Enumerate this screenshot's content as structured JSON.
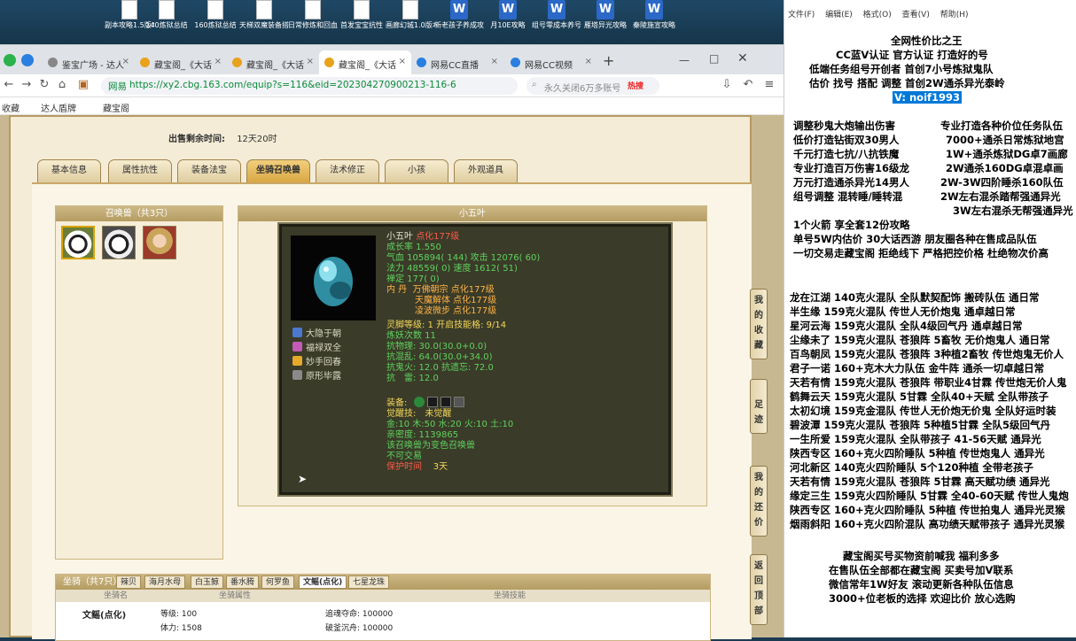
{
  "desktop_icons": [
    {
      "label": "副本攻略1.5版本",
      "type": "doc"
    },
    {
      "label": "140炼狱总结",
      "type": "doc"
    },
    {
      "label": "160炼狱总结",
      "type": "doc"
    },
    {
      "label": "天梯双魔装备搭配",
      "type": "doc"
    },
    {
      "label": "日常修炼和回血鬼搭配",
      "type": "doc"
    },
    {
      "label": "首发宝宝抗性",
      "type": "doc"
    },
    {
      "label": "画廊幻城1.0版本",
      "type": "doc"
    },
    {
      "label": "新老孩子养成攻略",
      "type": "word"
    },
    {
      "label": "月10E攻略",
      "type": "word"
    },
    {
      "label": "组号零成本养号",
      "type": "word"
    },
    {
      "label": "雁塔异光攻略",
      "type": "word"
    },
    {
      "label": "秦陵施宣攻略",
      "type": "word"
    }
  ],
  "browser": {
    "tabs": [
      {
        "label": "鉴宝广场 - 达人",
        "active": false
      },
      {
        "label": "藏宝阁_《大话",
        "active": false
      },
      {
        "label": "藏宝阁_《大话",
        "active": false
      },
      {
        "label": "藏宝阁_《大话",
        "active": true
      },
      {
        "label": "网易CC直播",
        "active": false
      },
      {
        "label": "网易CC视频",
        "active": false
      }
    ],
    "url_host": "网易",
    "url": "https://xy2.cbg.163.com/equip?s=116&eid=202304270900213-116-6",
    "search_placeholder": "永久关闭6万多账号",
    "hot_label": "热搜",
    "bookmarks": [
      "收藏",
      "达人盾牌",
      "藏宝阁"
    ]
  },
  "listing": {
    "time_left_label": "出售剩余时间:",
    "time_left_value": "12天20时",
    "tabs": [
      "基本信息",
      "属性抗性",
      "装备法宝",
      "坐骑召唤兽",
      "法术修正",
      "小孩",
      "外观道具"
    ],
    "active_tab": "坐骑召唤兽",
    "pet_list_title": "召唤兽（共3只）",
    "pet_detail_title": "小五叶"
  },
  "pet": {
    "name": "小五叶",
    "tag": "点化177级",
    "growth": "成长率 1.550",
    "hp": "气血 105894( 144)",
    "atk": "攻击 12076( 60)",
    "mp": "法力 48559( 0)",
    "spd": "速度 1612( 51)",
    "ding": "禅定 177( 0)",
    "inner_label": "内 丹",
    "inner": [
      "万佛朝宗 点化177级",
      "天魔解体 点化177级",
      "凌波微步 点化177级"
    ],
    "skills": [
      "大隐于朝",
      "福禄双全",
      "妙手回春",
      "原形毕露"
    ],
    "spirit": "灵脚等级: 1 开启技能格: 9/14",
    "refine": "炼妖次数 11",
    "res1": "抗物理: 30.0(30.0+0.0)",
    "res2": "抗混乱: 64.0(30.0+34.0)",
    "res3a": "抗鬼火: 12.0",
    "res3b": "抗遗忘: 72.0",
    "res4": "抗　雷: 12.0",
    "equip_label": "装备:",
    "awaken": "觉醒技:　未觉醒",
    "elements": "金:10 木:50 水:20 火:10 土:10",
    "close": "亲密度: 1139865",
    "note1": "该召唤兽为变色召唤兽",
    "note2": "不可交易",
    "protect_label": "保护时间",
    "protect_value": "3天"
  },
  "mounts": {
    "header": "坐骑（共7只）",
    "tabs": [
      "辣贝",
      "海月水母",
      "白玉鲸",
      "番水腾",
      "何罗鱼",
      "文鳐(点化)",
      "七星龙珠"
    ],
    "active_tab": "文鳐(点化)",
    "cols": [
      "坐骑名",
      "坐骑属性",
      "坐骑技能"
    ],
    "name": "文鳐(点化)",
    "level": "等级: 100",
    "body": "体力: 1508",
    "chase": "追魂夺命: 100000",
    "wave": "破釜沉舟: 100000"
  },
  "side_buttons": [
    "我的收藏",
    "足迹",
    "我的还价",
    "返回顶部"
  ],
  "notepad": {
    "menu": [
      "文件(F)",
      "编辑(E)",
      "格式(O)",
      "查看(V)",
      "帮助(H)"
    ],
    "header_lines": [
      "全网性价比之王",
      "CC蓝V认证 官方认证 打造好的号",
      "低端任务组号开创者     首创7小号炼狱鬼队",
      "估价 找号 搭配 调整        首创2W通杀异光泰岭"
    ],
    "contact": "V: noif1993",
    "services_left": [
      "调整秒鬼大炮输出伤害",
      "低价打造钻街双30男人",
      "千元打造七抗/八抗铁魔",
      "专业打造百万伤害16级龙",
      "万元打造通杀异光14男人",
      "组号调整 混转睡/睡转混"
    ],
    "services_right": [
      "专业打造各种价位任务队伍",
      "7000+通杀日常炼狱地宫",
      "1W+通杀炼狱DG卓7画廊",
      "2W通杀160DG卓混卓画",
      "2W-3W四阶睡杀160队伍",
      "2W左右混杀踏帮强通异光",
      "3W左右混杀无帮强通异光"
    ],
    "promo": [
      "1个火箭 享全套12份攻略",
      "单号5W内估价 30大话西游        朋友圈各种在售成品队伍",
      "一切交易走藏宝阁 拒绝线下    严格把控价格 杜绝物次价高"
    ],
    "teams": [
      "龙在江湖 140克火混队 全队默契配饰 搬砖队伍 通日常",
      "半生缘     159克火混队 传世人无价炮鬼 通卓越日常",
      "星河云海 159克火混队 全队4级回气丹 通卓越日常",
      "尘缘未了 159克火混队 苍狼阵 5畜牧 无价炮鬼人 通日常",
      "百鸟朝凤 159克火混队 苍狼阵 3种植2畜牧 传世炮鬼无价人",
      "君子一诺 160+克木大力队伍 金牛阵 通杀一切卓越日常",
      "天若有情 159克火混队 苍狼阵 带职业4甘霖 传世炮无价人鬼",
      "鹤舞云天 159克火混队 5甘霖 全队40+天赋 全队带孩子",
      "太初幻境 159克金混队 传世人无价炮无价鬼 全队好运时装",
      "碧波潭      159克火混队 苍狼阵 5种植5甘霖 全队5级回气丹",
      "一生所爱 159克火混队 全队带孩子 41-56天赋 通异光",
      "陕西专区 160+克火四阶睡队 5种植 传世炮鬼人 通异光",
      "河北新区 140克火四阶睡队 5个120种植 全带老孩子",
      "天若有情 159克火混队 苍狼阵 5甘霖 高天赋功绩 通异光",
      "缘定三生 159克火四阶睡队 5甘霖 全40-60天赋 传世人鬼炮",
      "陕西专区 160+克火四阶睡队 5种植 传世拍鬼人 通异光灵猴",
      "烟雨斜阳 160+克火四阶混队 高功绩天赋带孩子 通异光灵猴"
    ],
    "footer": [
      "藏宝阁买号买物资前喊我 福利多多",
      "在售队伍全部都在藏宝阁 买卖号加V联系",
      "微信常年1W好友 滚动更新各种队伍信息",
      "3000+位老板的选择 欢迎比价 放心选购"
    ]
  }
}
